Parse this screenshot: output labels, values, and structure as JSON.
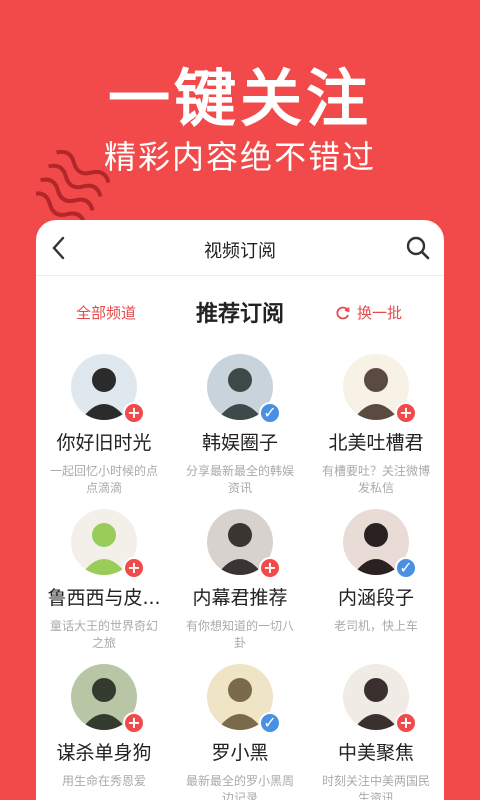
{
  "hero": {
    "title": "一键关注",
    "subtitle": "精彩内容绝不错过"
  },
  "topbar": {
    "title": "视频订阅",
    "back_icon": "back-arrow-icon",
    "search_icon": "search-icon"
  },
  "section": {
    "all_channels": "全部频道",
    "title": "推荐订阅",
    "refresh": "换一批"
  },
  "colors": {
    "brand": "#f24a4a",
    "follow_badge": "#f24a4a",
    "followed_badge": "#4a90e2"
  },
  "channels": [
    {
      "name": "你好旧时光",
      "desc": "一起回忆小时候的点点滴滴",
      "followed": false,
      "avatar_bg": "#dfe7ef",
      "avatar_fg": "#2b2b2b"
    },
    {
      "name": "韩娱圈子",
      "desc": "分享最新最全的韩娱资讯",
      "followed": true,
      "avatar_bg": "#c9d3dc",
      "avatar_fg": "#3d4a4a"
    },
    {
      "name": "北美吐槽君",
      "desc": "有槽要吐？关注微博发私信",
      "followed": false,
      "avatar_bg": "#f7f1e6",
      "avatar_fg": "#5a4a40"
    },
    {
      "name": "鲁西西与皮...",
      "desc": "童话大王的世界奇幻之旅",
      "followed": false,
      "avatar_bg": "#f3f0ea",
      "avatar_fg": "#9acc5a"
    },
    {
      "name": "内幕君推荐",
      "desc": "有你想知道的一切八卦",
      "followed": false,
      "avatar_bg": "#d8d2cf",
      "avatar_fg": "#3a3533"
    },
    {
      "name": "内涵段子",
      "desc": "老司机，快上车",
      "followed": true,
      "avatar_bg": "#e9dcd6",
      "avatar_fg": "#2a2222"
    },
    {
      "name": "谋杀单身狗",
      "desc": "用生命在秀恩爱",
      "followed": false,
      "avatar_bg": "#b8c6a5",
      "avatar_fg": "#353a2f"
    },
    {
      "name": "罗小黑",
      "desc": "最新最全的罗小黑周边记录",
      "followed": true,
      "avatar_bg": "#efe4c6",
      "avatar_fg": "#7a6a4a"
    },
    {
      "name": "中美聚焦",
      "desc": "时刻关注中美两国民生资讯",
      "followed": false,
      "avatar_bg": "#f1ebe6",
      "avatar_fg": "#3a3030"
    }
  ]
}
